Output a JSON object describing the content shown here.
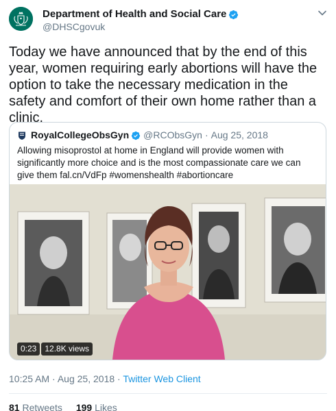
{
  "author": {
    "display_name": "Department of Health and Social Care",
    "handle": "@DHSCgovuk",
    "avatar_icon": "royal-coat-of-arms-icon",
    "verified": true
  },
  "tweet": {
    "text": "Today we have announced that by the end of this year, women requiring early abortions will have the option to take the necessary medication in the safety and comfort of their own home rather than a clinic."
  },
  "quoted_tweet": {
    "display_name": "RoyalCollegeObsGyn",
    "handle": "@RCObsGyn",
    "separator": "·",
    "date": "Aug 25, 2018",
    "verified": true,
    "text": "Allowing misoprostol at home in England will provide women with significantly more choice and is the most compassionate care we can give them fal.cn/VdFp #womenshealth #abortioncare",
    "video": {
      "duration": "0:23",
      "views": "12.8K views"
    }
  },
  "meta": {
    "time": "10:25 AM",
    "separator_1": "·",
    "date": "Aug 25, 2018",
    "separator_2": "·",
    "client": "Twitter Web Client"
  },
  "stats": {
    "retweets_count": "81",
    "retweets_label": "Retweets",
    "likes_count": "199",
    "likes_label": "Likes"
  },
  "colors": {
    "accent": "#1b95e0",
    "verified": "#1da1f2",
    "muted_text": "#657786",
    "dhsc_green": "#007261"
  }
}
